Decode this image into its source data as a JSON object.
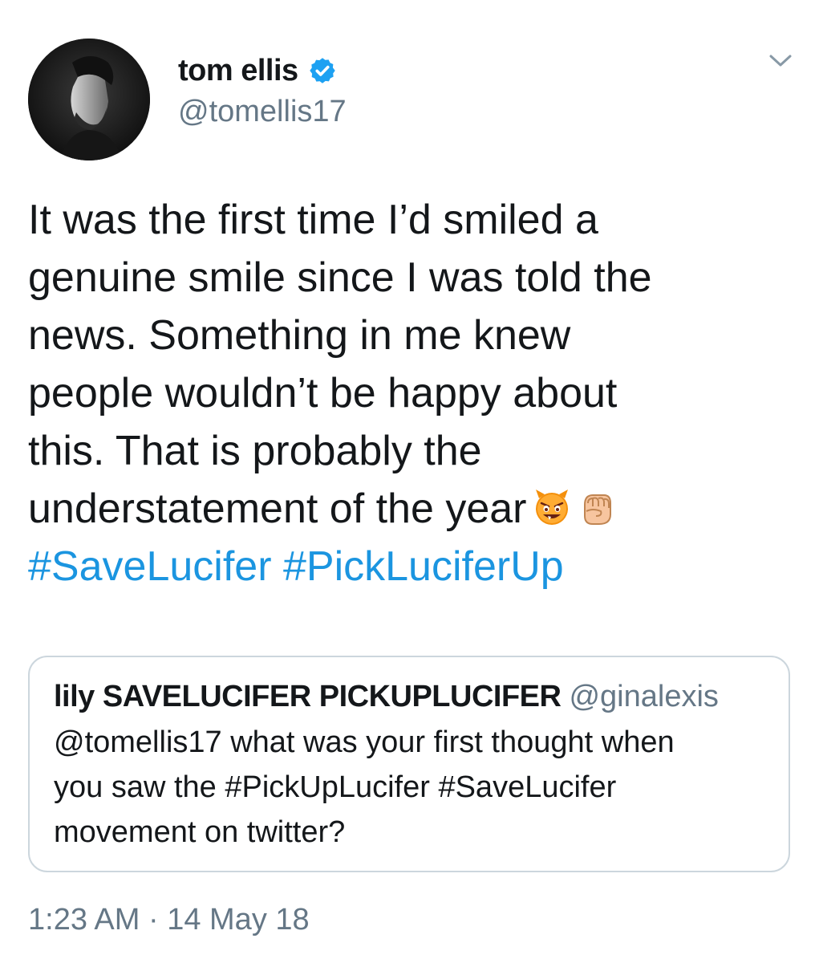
{
  "author": {
    "display_name": "tom ellis",
    "handle": "@tomellis17",
    "verified_icon": "verified-badge-icon",
    "avatar_icon": "avatar-photo"
  },
  "menu": {
    "icon": "chevron-down-icon"
  },
  "tweet": {
    "lines": [
      "It was the first time I’d smiled a",
      "genuine smile since I was told the",
      "news. Something in me knew",
      "people wouldn’t be happy about",
      "this. That is probably the",
      "understatement of the year"
    ],
    "emojis": [
      "smiling-imp-emoji",
      "raised-fist-emoji"
    ],
    "hashtags": [
      "#SaveLucifer",
      "#PickLuciferUp"
    ]
  },
  "quote": {
    "display_name": "lily SAVELUCIFER PICKUPLUCIFER",
    "handle": "@ginalexis",
    "lines": [
      "@tomellis17 what was your first thought when",
      "you saw the #PickUpLucifer #SaveLucifer",
      "movement on twitter?"
    ]
  },
  "timestamp": {
    "time": "1:23 AM",
    "separator": "·",
    "date": "14 May 18"
  },
  "colors": {
    "text": "#14171a",
    "secondary": "#657786",
    "link": "#1b95e0",
    "verified": "#1da1f2",
    "border": "#ccd6dd"
  }
}
